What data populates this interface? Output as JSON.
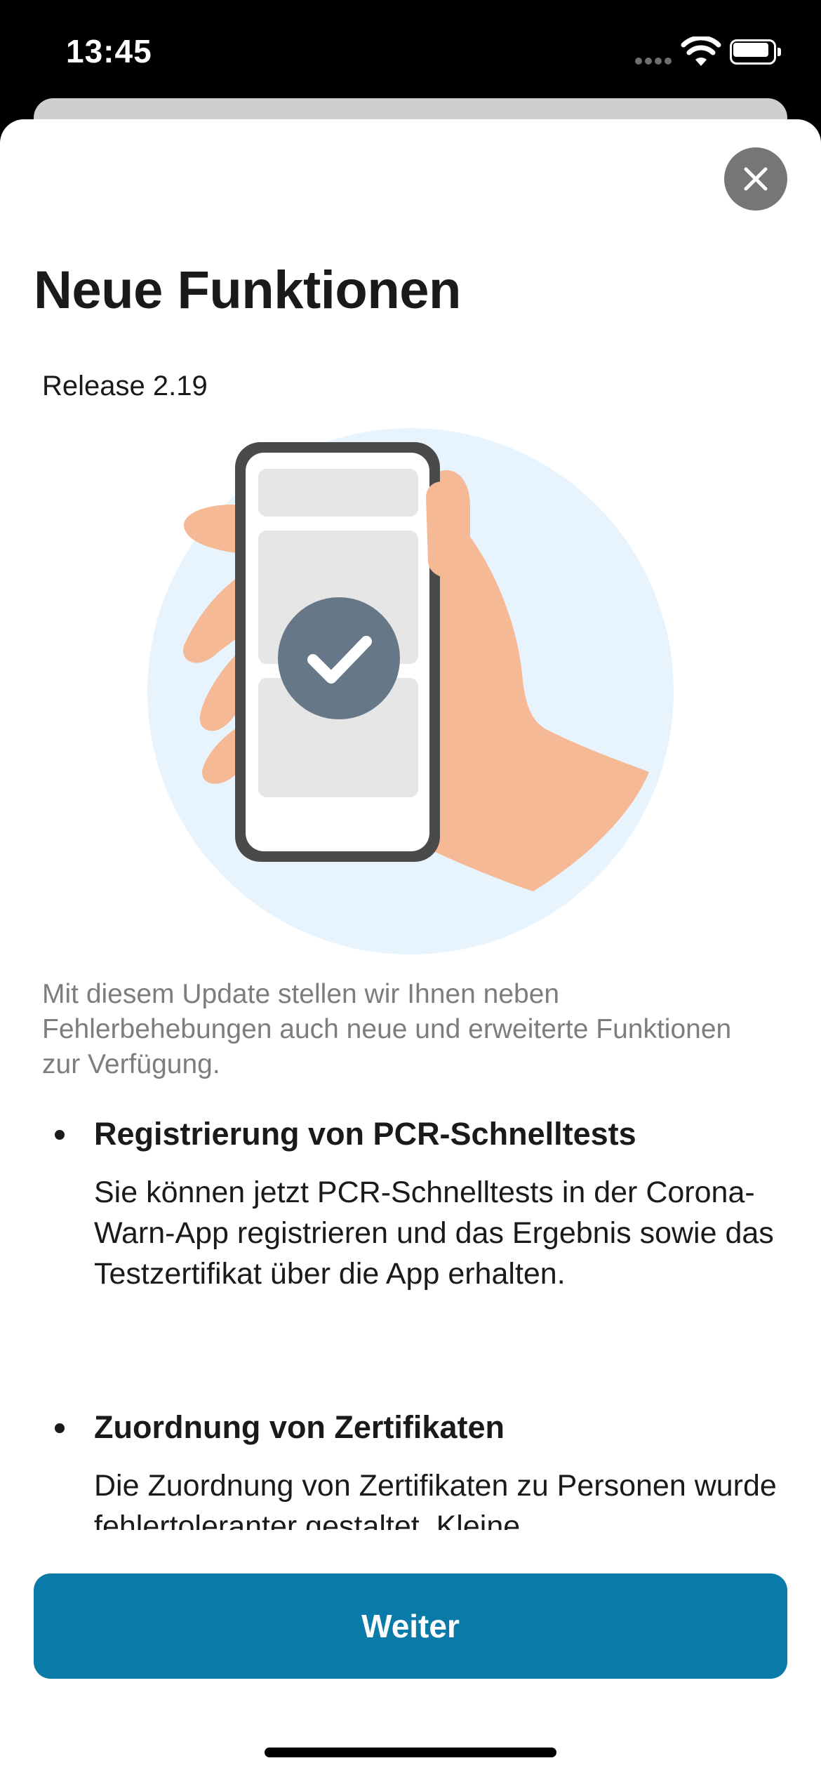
{
  "status_bar": {
    "time": "13:45"
  },
  "sheet": {
    "close_label": "×",
    "title": "Neue Funktionen",
    "release": "Release 2.19",
    "intro": "Mit diesem Update stellen wir Ihnen neben Fehlerbehebungen auch neue und erweiterte Funktionen zur Verfügung.",
    "features": [
      {
        "title": "Registrierung von PCR-Schnelltests",
        "body": "Sie können jetzt PCR-Schnelltests in der Corona-Warn-App registrieren und das Ergebnis sowie das Testzertifikat über die App erhalten."
      },
      {
        "title": "Zuordnung von Zertifikaten",
        "body": "Die Zuordnung von Zertifikaten zu Personen wurde fehlertoleranter gestaltet. Kleine"
      }
    ],
    "continue_label": "Weiter"
  },
  "colors": {
    "accent": "#0a7ba8",
    "illustration_circle": "#e8f4fd",
    "skin": "#f5b995",
    "phone_frame": "#4a4a4a",
    "check_circle": "#667788"
  }
}
